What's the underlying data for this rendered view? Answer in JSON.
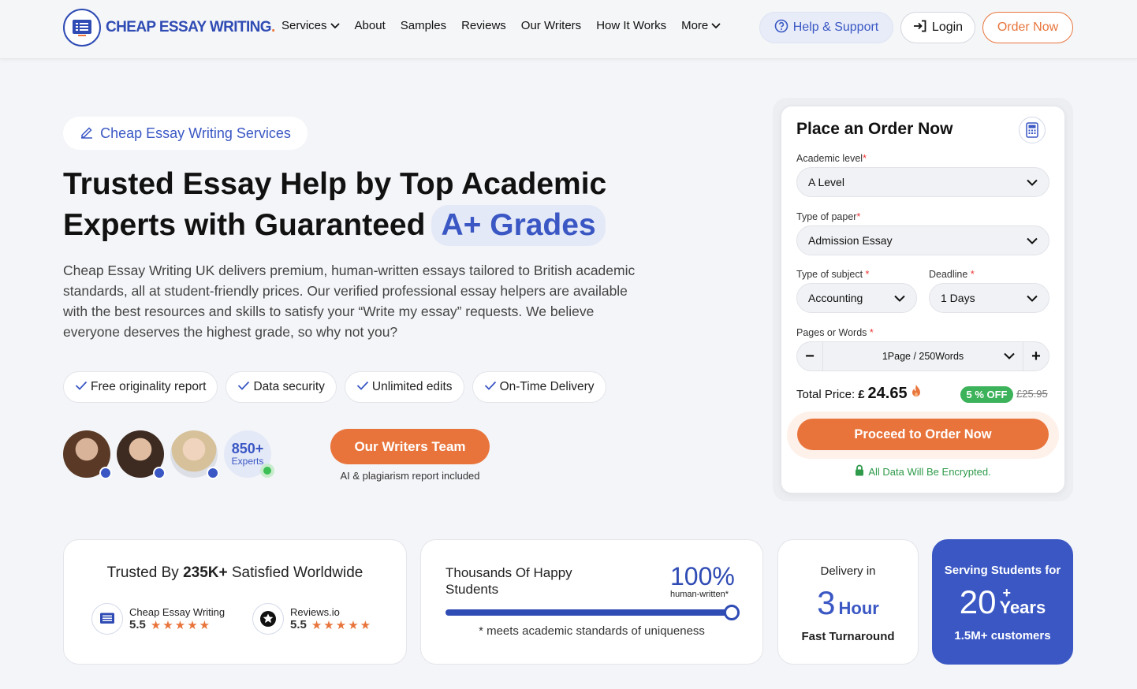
{
  "header": {
    "logo_text": "CHEAP ESSAY WRITING",
    "nav": [
      {
        "label": "Services"
      },
      {
        "label": "About"
      },
      {
        "label": "Samples"
      },
      {
        "label": "Reviews"
      },
      {
        "label": "Our Writers"
      },
      {
        "label": "How It Works"
      },
      {
        "label": "More"
      }
    ],
    "help_label": "Help & Support",
    "login_label": "Login",
    "order_label": "Order Now"
  },
  "hero": {
    "badge": "Cheap Essay Writing Services",
    "title_line1": "Trusted Essay Help by Top Academic",
    "title_line2": "Experts with Guaranteed",
    "title_highlight": "A+ Grades",
    "description": "Cheap Essay Writing UK delivers premium, human-written essays tailored to British academic standards, all at student-friendly prices. Our verified professional essay helpers are available with the best resources and skills to satisfy your “Write my essay” requests. We believe everyone deserves the highest grade, so why not you?",
    "features": [
      "Free originality report",
      "Data security",
      "Unlimited edits",
      "On-Time Delivery"
    ],
    "experts_count": "850+",
    "experts_label": "Experts",
    "writers_button": "Our Writers Team",
    "writers_note": "AI & plagiarism report included"
  },
  "order_form": {
    "title": "Place an Order Now",
    "academic_level_label": "Academic level",
    "academic_level_value": "A Level",
    "paper_type_label": "Type of paper",
    "paper_type_value": "Admission Essay",
    "subject_label": "Type of subject",
    "subject_value": "Accounting",
    "deadline_label": "Deadline",
    "deadline_value": "1 Days",
    "pages_label": "Pages or Words",
    "pages_value": "1Page / 250Words",
    "total_label": "Total Price:",
    "currency": "£",
    "total_value": "24.65",
    "discount": "5 % OFF",
    "old_price": "£25.95",
    "proceed_label": "Proceed to Order Now",
    "encrypted_note": "All Data Will Be Encrypted."
  },
  "stats": {
    "trusted_prefix": "Trusted By",
    "trusted_count": "235K+",
    "trusted_suffix": "Satisfied Worldwide",
    "review1_name": "Cheap Essay Writing",
    "review1_score": "5.5",
    "review2_name": "Reviews.io",
    "review2_score": "5.5",
    "happy_title": "Thousands Of Happy Students",
    "happy_percent": "100%",
    "happy_percent_label": "human-written*",
    "happy_progress": 1.0,
    "happy_note": "* meets academic standards of uniqueness",
    "delivery_label": "Delivery in",
    "delivery_num": "3",
    "delivery_unit": "Hour",
    "delivery_sub": "Fast Turnaround",
    "serving_label": "Serving Students for",
    "serving_num": "20",
    "serving_plus": "+",
    "serving_unit": "Years",
    "serving_sub": "1.5M+ customers"
  },
  "colors": {
    "brand_blue": "#3a57c4",
    "accent_orange": "#e8743b",
    "success_green": "#3cb25a"
  }
}
